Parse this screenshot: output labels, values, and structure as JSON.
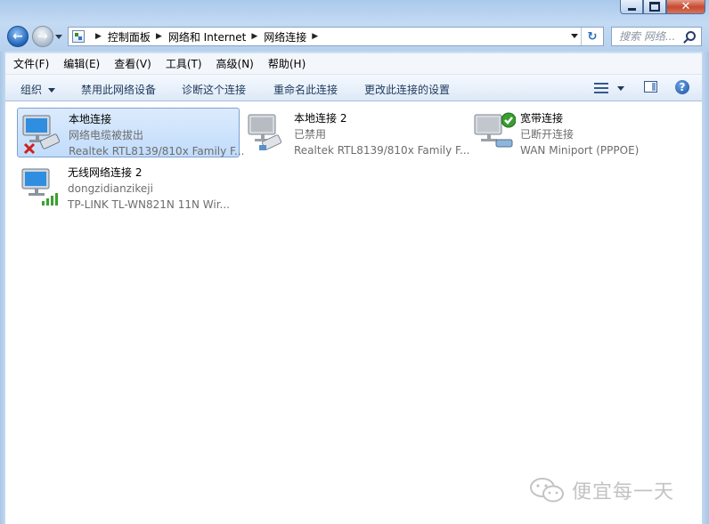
{
  "window": {
    "controls": {
      "minimize": "minimize",
      "maximize": "maximize",
      "close": "✕"
    }
  },
  "address_bar": {
    "breadcrumbs": [
      "控制面板",
      "网络和 Internet",
      "网络连接"
    ]
  },
  "search": {
    "placeholder": "搜索 网络..."
  },
  "menu": {
    "items": [
      "文件(F)",
      "编辑(E)",
      "查看(V)",
      "工具(T)",
      "高级(N)",
      "帮助(H)"
    ]
  },
  "toolbar": {
    "organize": "组织",
    "disable_device": "禁用此网络设备",
    "diagnose": "诊断这个连接",
    "rename": "重命名此连接",
    "change_settings": "更改此连接的设置",
    "help": "?"
  },
  "connections": [
    {
      "name": "本地连接",
      "status": "网络电缆被拔出",
      "device": "Realtek RTL8139/810x Family F...",
      "state_icon": "red-x-icon",
      "selected": true
    },
    {
      "name": "本地连接 2",
      "status": "已禁用",
      "device": "Realtek RTL8139/810x Family F...",
      "state_icon": "disabled-cable-icon",
      "selected": false
    },
    {
      "name": "宽带连接",
      "status": "已断开连接",
      "device": "WAN Miniport (PPPOE)",
      "state_icon": "green-check-icon",
      "selected": false
    },
    {
      "name": "无线网络连接 2",
      "status": "dongzidianzikeji",
      "device": "TP-LINK TL-WN821N 11N Wir...",
      "state_icon": "signal-bars-icon",
      "selected": false
    }
  ],
  "watermark": {
    "text": "便宜每一天"
  },
  "colors": {
    "selection_bg": "#c9e0fc",
    "selection_border": "#7da2ce",
    "secondary_text": "#6d6d6d",
    "command_text": "#1e395b"
  }
}
